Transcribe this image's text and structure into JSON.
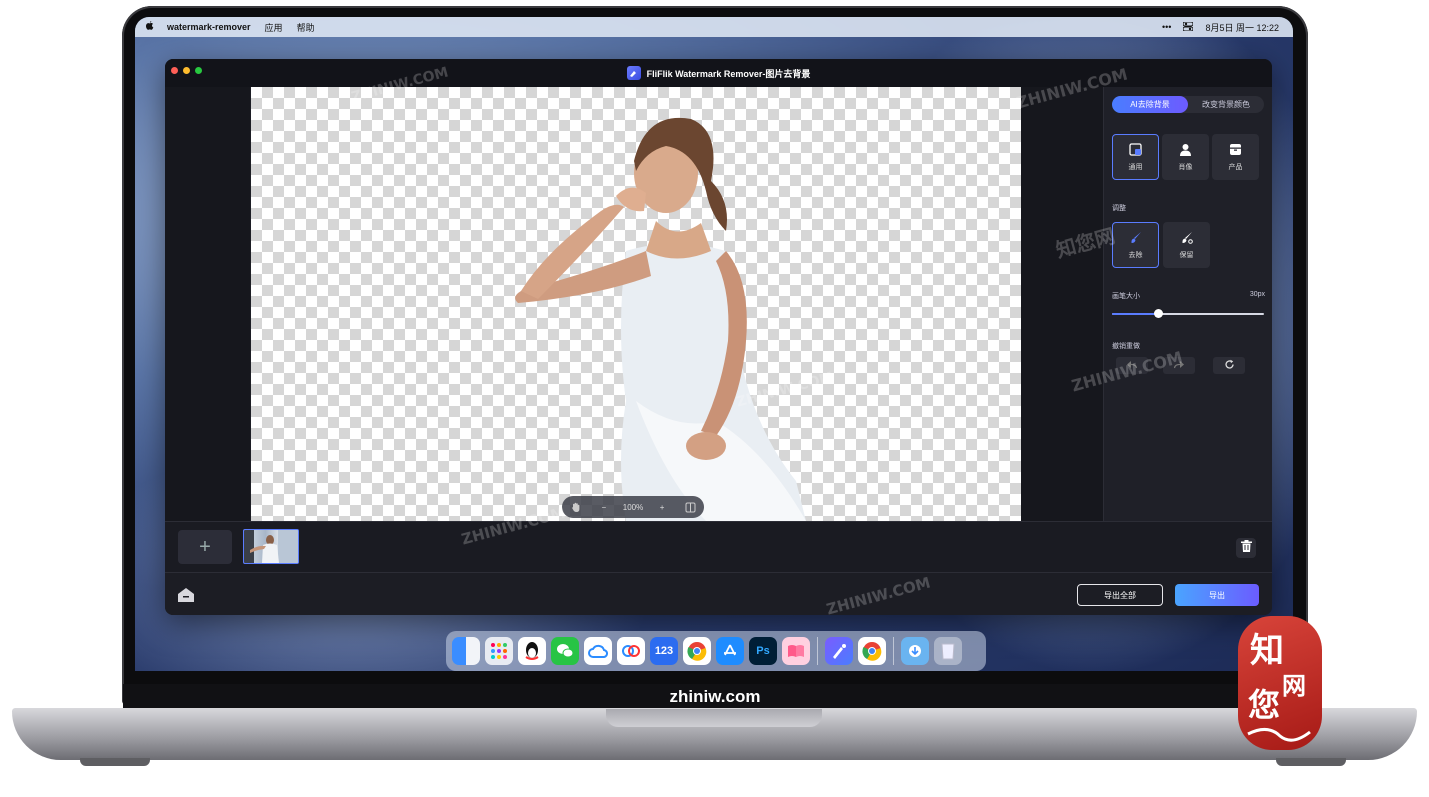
{
  "menubar": {
    "app_name": "watermark-remover",
    "menus": [
      "应用",
      "帮助"
    ],
    "right": {
      "more": "•••",
      "date_time": "8月5日 周一 12:22"
    }
  },
  "window": {
    "title": "FliFlik Watermark Remover-图片去背景",
    "traffic_lights": {
      "close": "#ff5f57",
      "minimize": "#febc2e",
      "zoom": "#28c840"
    }
  },
  "zoom": {
    "level": "100%",
    "zoom_out": "−",
    "zoom_in": "+"
  },
  "panel": {
    "tabs": [
      {
        "label": "AI去除背景",
        "active": true
      },
      {
        "label": "改变背景颜色",
        "active": false
      }
    ],
    "modes": [
      {
        "label": "通用",
        "icon": "general-icon",
        "selected": true
      },
      {
        "label": "肖像",
        "icon": "portrait-icon",
        "selected": false
      },
      {
        "label": "产品",
        "icon": "product-icon",
        "selected": false
      }
    ],
    "adjust_label": "调整",
    "tools": [
      {
        "label": "去除",
        "icon": "erase-brush-icon",
        "selected": true
      },
      {
        "label": "保留",
        "icon": "keep-brush-icon",
        "selected": false
      }
    ],
    "brush": {
      "label": "画笔大小",
      "value_text": "30px",
      "fraction": 0.3
    },
    "history_label": "撤销重做"
  },
  "thumbstrip": {
    "add": "+"
  },
  "bottom": {
    "export_all": "导出全部",
    "export": "导出"
  },
  "dock": {
    "numbers_label": "123",
    "ps_label": "Ps"
  },
  "laptop": {
    "site_caption": "zhiniw.com"
  },
  "watermarks": {
    "text": "ZHINIW.COM",
    "cn": "知您网"
  },
  "badge": {
    "line1": "知",
    "line2": "网",
    "line3": "您"
  },
  "colors": {
    "accent": "#5a7cff",
    "export_gradient_start": "#4aa4ff",
    "export_gradient_end": "#6b5cff",
    "app_bg": "#1c1d24"
  }
}
